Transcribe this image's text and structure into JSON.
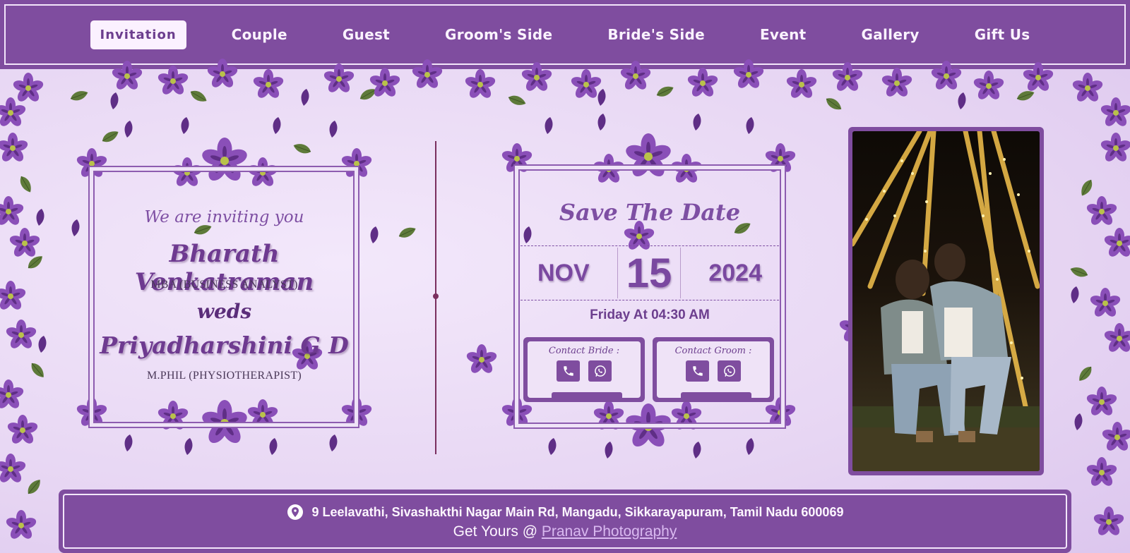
{
  "nav": {
    "items": [
      {
        "label": "Invitation",
        "active": true
      },
      {
        "label": "Couple",
        "active": false
      },
      {
        "label": "Guest",
        "active": false
      },
      {
        "label": "Groom's Side",
        "active": false
      },
      {
        "label": "Bride's Side",
        "active": false
      },
      {
        "label": "Event",
        "active": false
      },
      {
        "label": "Gallery",
        "active": false
      },
      {
        "label": "Gift Us",
        "active": false
      }
    ]
  },
  "invitation": {
    "intro": "We are inviting you",
    "groom_name": "Bharath Venkatraman",
    "groom_degree": "MBA (BUSINESS ANALYST)",
    "weds": "weds",
    "bride_name": "Priyadharshini G D",
    "bride_degree": "M.PHIL (PHYSIOTHERAPIST)"
  },
  "save_the_date": {
    "title": "Save The Date",
    "month": "NOV",
    "day": "15",
    "year": "2024",
    "time": "Friday At 04:30 AM",
    "contact_bride_label": "Contact Bride :",
    "contact_groom_label": "Contact Groom :"
  },
  "footer": {
    "address": "9 Leelavathi, Sivashakthi Nagar Main Rd, Mangadu, Sikkarayapuram, Tamil Nadu 600069",
    "credit_prefix": "Get Yours @",
    "credit_link": "Pranav Photography"
  },
  "icons": {
    "location": "location-pin-icon",
    "phone": "phone-icon",
    "whatsapp": "whatsapp-icon",
    "flower": "flower-icon",
    "leaf": "leaf-icon"
  },
  "colors": {
    "primary": "#7f4d9f",
    "background": "#efe3f7",
    "accent_text": "#6e3a90",
    "flower": "#8a4fb8",
    "leaf": "#5e7a3a"
  }
}
